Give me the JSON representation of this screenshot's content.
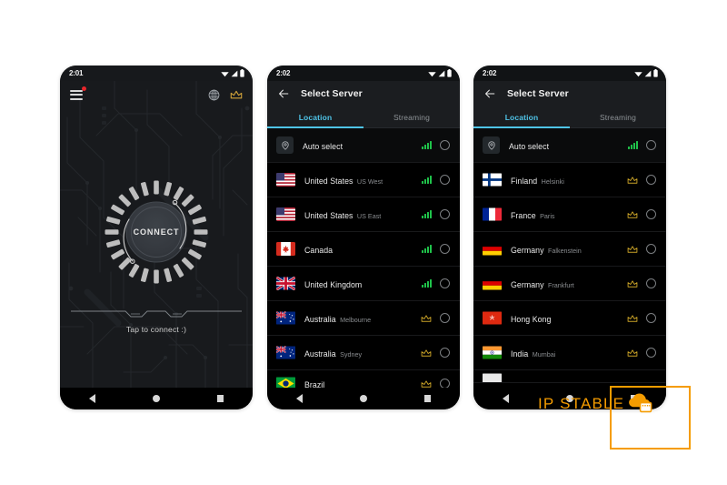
{
  "page": {
    "background": "#ffffff",
    "accent_orange": "#f59c00",
    "accent_cyan": "#4fc4e8",
    "accent_gold": "#c9a227",
    "signal_green": "#1fc24a"
  },
  "watermark": {
    "text": "IP STABLE",
    "color": "#f59c00",
    "icon": "cloud-server-icon",
    "frame": "orange-rectangle-frame"
  },
  "navbar": {
    "back": "back-triangle",
    "home": "home-circle",
    "recents": "recents-square"
  },
  "phone1": {
    "statusbar": {
      "time": "2:01",
      "icons": [
        "wifi-icon",
        "signal-icon",
        "battery-icon"
      ]
    },
    "appbar": {
      "menu_icon": "hamburger-menu-icon",
      "notification_dot": true,
      "globe_icon": "globe-icon",
      "crown_icon": "crown-icon"
    },
    "connect": {
      "button_label": "CONNECT",
      "hint": "Tap to connect :)"
    }
  },
  "phone2": {
    "statusbar": {
      "time": "2:02",
      "icons": [
        "wifi-icon",
        "signal-icon",
        "battery-icon"
      ]
    },
    "appbar": {
      "back_icon": "arrow-back-icon",
      "title": "Select Server"
    },
    "tabs": [
      {
        "label": "Location",
        "active": true
      },
      {
        "label": "Streaming",
        "active": false
      }
    ],
    "servers": [
      {
        "name": "Auto select",
        "sub": "",
        "flag": "",
        "icon": "location-pin-icon",
        "indicator": "signal",
        "selected": false
      },
      {
        "name": "United States",
        "sub": "US West",
        "flag": "🇺🇸",
        "indicator": "signal",
        "selected": false
      },
      {
        "name": "United States",
        "sub": "US East",
        "flag": "🇺🇸",
        "indicator": "signal",
        "selected": false
      },
      {
        "name": "Canada",
        "sub": "",
        "flag": "🇨🇦",
        "indicator": "signal",
        "selected": false
      },
      {
        "name": "United Kingdom",
        "sub": "",
        "flag": "🇬🇧",
        "indicator": "signal",
        "selected": false
      },
      {
        "name": "Australia",
        "sub": "Melbourne",
        "flag": "🇦🇺",
        "indicator": "crown",
        "selected": false
      },
      {
        "name": "Australia",
        "sub": "Sydney",
        "flag": "🇦🇺",
        "indicator": "crown",
        "selected": false
      },
      {
        "name": "Brazil",
        "sub": "",
        "flag": "🇧🇷",
        "indicator": "crown",
        "selected": false,
        "partial": true
      }
    ]
  },
  "phone3": {
    "statusbar": {
      "time": "2:02",
      "icons": [
        "wifi-icon",
        "signal-icon",
        "battery-icon"
      ]
    },
    "appbar": {
      "back_icon": "arrow-back-icon",
      "title": "Select Server"
    },
    "tabs": [
      {
        "label": "Location",
        "active": true
      },
      {
        "label": "Streaming",
        "active": false
      }
    ],
    "servers": [
      {
        "name": "Auto select",
        "sub": "",
        "flag": "",
        "icon": "location-pin-icon",
        "indicator": "signal",
        "selected": false
      },
      {
        "name": "Finland",
        "sub": "Helsinki",
        "flag": "🇫🇮",
        "indicator": "crown",
        "selected": false
      },
      {
        "name": "France",
        "sub": "Paris",
        "flag": "🇫🇷",
        "indicator": "crown",
        "selected": false
      },
      {
        "name": "Germany",
        "sub": "Falkenstein",
        "flag": "🇩🇪",
        "indicator": "crown",
        "selected": false
      },
      {
        "name": "Germany",
        "sub": "Frankfurt",
        "flag": "🇩🇪",
        "indicator": "crown",
        "selected": false
      },
      {
        "name": "Hong Kong",
        "sub": "",
        "flag": "🇭🇰",
        "indicator": "crown",
        "selected": false
      },
      {
        "name": "India",
        "sub": "Mumbai",
        "flag": "🇮🇳",
        "indicator": "crown",
        "selected": false
      },
      {
        "name": "",
        "sub": "",
        "flag": "",
        "indicator": "none",
        "selected": false,
        "partial": true
      }
    ]
  }
}
